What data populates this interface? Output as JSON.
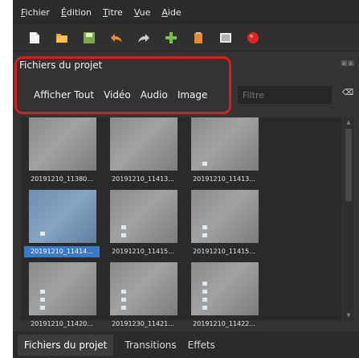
{
  "menu": [
    "Fichier",
    "Édition",
    "Titre",
    "Vue",
    "Aide"
  ],
  "toolbar": [
    "new-project-icon",
    "open-project-icon",
    "save-project-icon",
    "undo-icon",
    "redo-icon",
    "import-files-icon",
    "choose-profile-icon",
    "fullscreen-icon",
    "export-video-icon"
  ],
  "panel": {
    "title": "Fichiers du projet",
    "filters": [
      "Afficher Tout",
      "Vidéo",
      "Audio",
      "Image"
    ],
    "filter_placeholder": "Filtre",
    "clear_label": "⌫"
  },
  "files": [
    "20191210_11380...",
    "20191210_11413...",
    "20191210_11413...",
    "20191210_11414...",
    "20191210_11415...",
    "20191210_11415...",
    "20191210_11420...",
    "20191230_11421...",
    "20191210_11422..."
  ],
  "selected_index": 3,
  "tabs": [
    "Fichiers du projet",
    "Transitions",
    "Effets"
  ],
  "colors": {
    "highlight": "#d42020",
    "selection": "#3a78c8"
  }
}
